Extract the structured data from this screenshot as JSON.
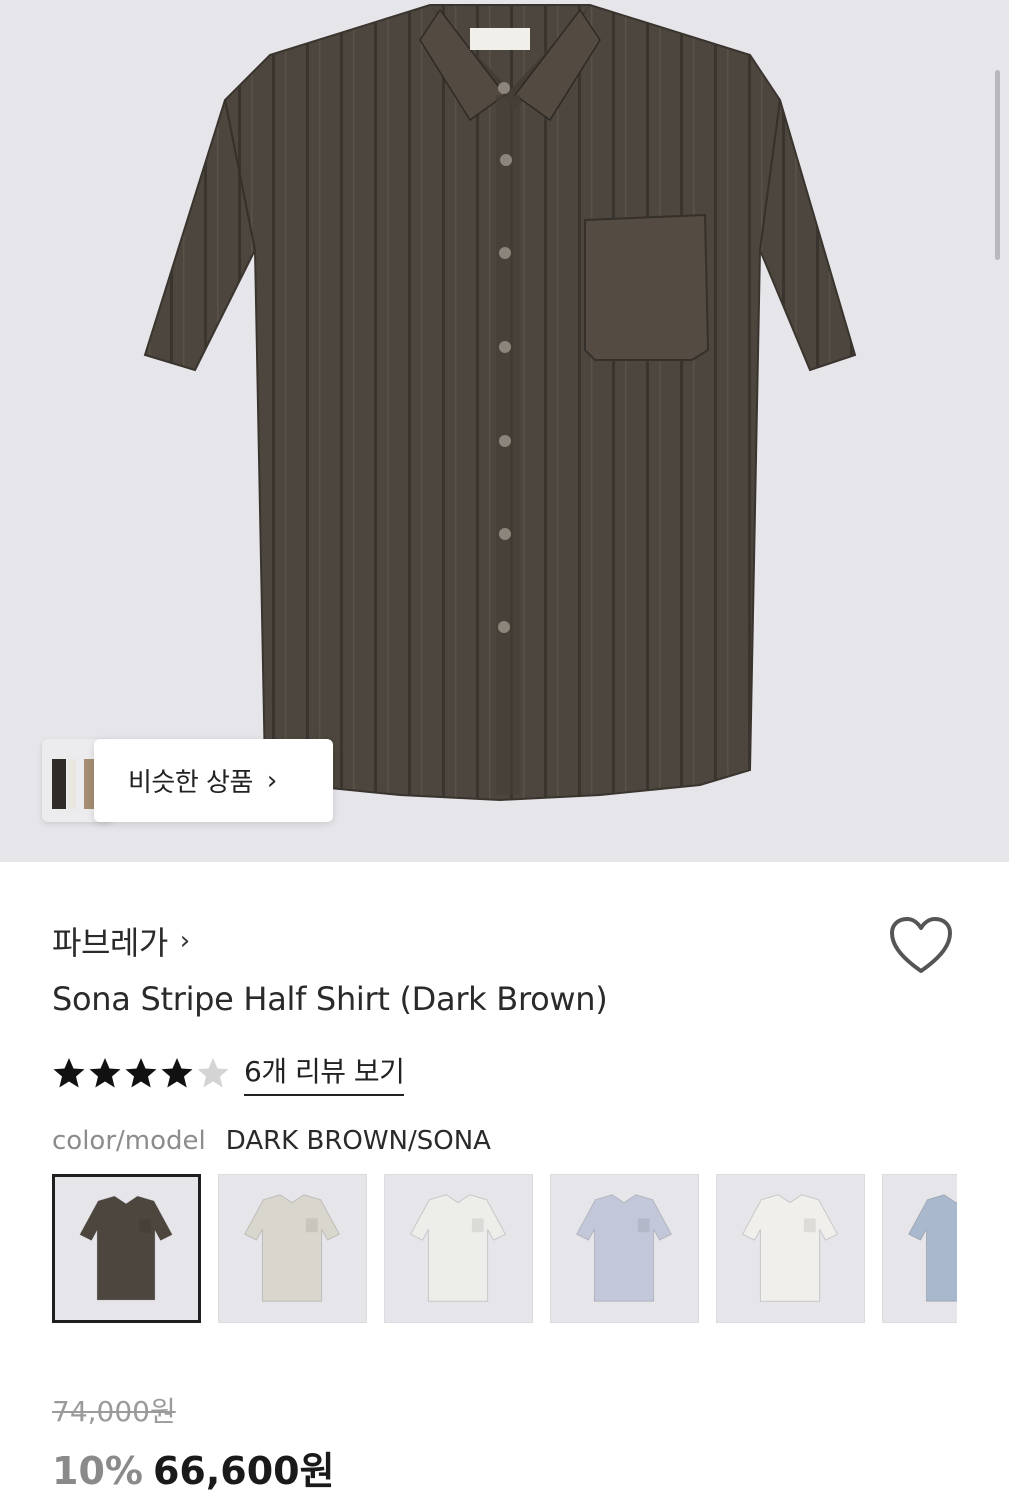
{
  "similar_button": {
    "label": "비슷한 상품",
    "chevron": "›"
  },
  "product": {
    "brand": "파브레가",
    "brand_chevron": "›",
    "title": "Sona Stripe Half Shirt (Dark Brown)",
    "rating": {
      "value": 4,
      "max": 5
    },
    "review_link": "6개 리뷰 보기",
    "color_model_label": "color/model",
    "color_model_value": "DARK BROWN/SONA",
    "swatch_colors": [
      "#4d463e",
      "#d9d6cd",
      "#ededea",
      "#c2c8da",
      "#f0efeb",
      "#a9b8cc"
    ],
    "selected_swatch_index": 0,
    "original_price": "74,000원",
    "discount": "10%",
    "price": "66,600원"
  },
  "colors": {
    "shirt": "#4d463e",
    "hero_background": "#e6e6ea",
    "star_filled": "#111111",
    "star_empty": "#d4d4d4"
  },
  "icons": {
    "heart": "heart-icon",
    "star": "star-icon",
    "chevron": "chevron-right-icon"
  }
}
